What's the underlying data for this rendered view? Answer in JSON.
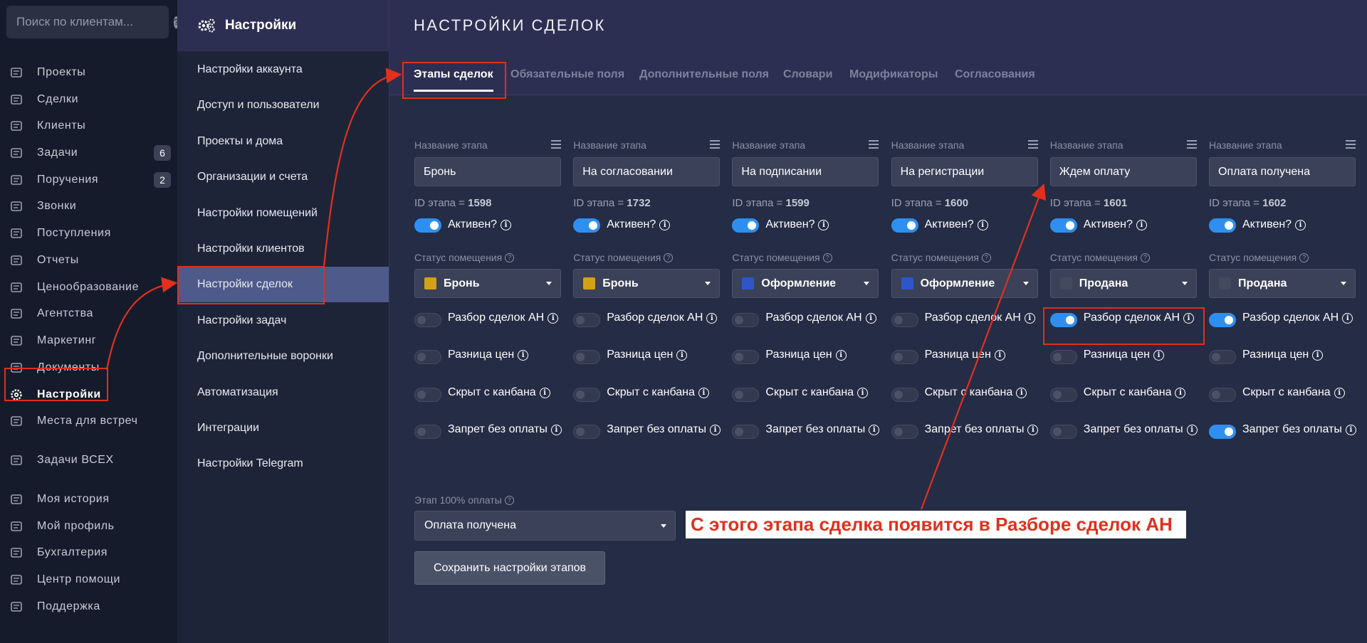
{
  "search": {
    "placeholder": "Поиск по клиентам..."
  },
  "nav": {
    "items": [
      {
        "label": "Проекты",
        "icon": "projects-icon"
      },
      {
        "label": "Сделки",
        "icon": "deals-icon"
      },
      {
        "label": "Клиенты",
        "icon": "clients-icon"
      },
      {
        "label": "Задачи",
        "icon": "tasks-icon",
        "badge": "6"
      },
      {
        "label": "Поручения",
        "icon": "assignments-icon",
        "badge": "2"
      },
      {
        "label": "Звонки",
        "icon": "calls-icon"
      },
      {
        "label": "Поступления",
        "icon": "receipts-icon"
      },
      {
        "label": "Отчеты",
        "icon": "reports-icon"
      },
      {
        "label": "Ценообразование",
        "icon": "pricing-icon"
      },
      {
        "label": "Агентства",
        "icon": "agencies-icon"
      },
      {
        "label": "Маркетинг",
        "icon": "marketing-icon"
      },
      {
        "label": "Документы",
        "icon": "documents-icon"
      },
      {
        "label": "Настройки",
        "icon": "gear-icon",
        "active": true
      },
      {
        "label": "Места для встреч",
        "icon": "meeting-places-icon"
      },
      {
        "label": "Задачи ВСЕХ",
        "icon": "all-tasks-icon"
      },
      {
        "label": "Моя история",
        "icon": "history-icon"
      },
      {
        "label": "Мой профиль",
        "icon": "profile-icon"
      },
      {
        "label": "Бухгалтерия",
        "icon": "accounting-icon"
      },
      {
        "label": "Центр помощи",
        "icon": "help-center-icon"
      },
      {
        "label": "Поддержка",
        "icon": "support-icon"
      }
    ]
  },
  "settings": {
    "title": "Настройки",
    "items": [
      "Настройки аккаунта",
      "Доступ и пользователи",
      "Проекты и дома",
      "Организации и счета",
      "Настройки помещений",
      "Настройки клиентов",
      "Настройки сделок",
      "Настройки задач",
      "Дополнительные воронки",
      "Автоматизация",
      "Интеграции",
      "Настройки Telegram"
    ],
    "active": "Настройки сделок"
  },
  "page": {
    "title": "НАСТРОЙКИ СДЕЛОК",
    "tabs": [
      "Этапы сделок",
      "Обязательные поля",
      "Дополнительные поля",
      "Словари",
      "Модификаторы",
      "Согласования"
    ],
    "active_tab": "Этапы сделок"
  },
  "labels": {
    "stage_name": "Название этапа",
    "stage_id_prefix": "ID этапа = ",
    "active": "Активен?",
    "room_status": "Статус помещения",
    "an_review": "Разбор сделок АН",
    "price_diff": "Разница цен",
    "hidden_kanban": "Скрыт с канбана",
    "no_payment_ban": "Запрет без оплаты"
  },
  "stages": [
    {
      "name": "Бронь",
      "id": "1598",
      "active": true,
      "status": "Бронь",
      "status_color": "#d4a017",
      "an_review": false,
      "price_diff": false,
      "hidden_kanban": false,
      "no_payment_ban": false
    },
    {
      "name": "На согласовании",
      "id": "1732",
      "active": true,
      "status": "Бронь",
      "status_color": "#d4a017",
      "an_review": false,
      "price_diff": false,
      "hidden_kanban": false,
      "no_payment_ban": false
    },
    {
      "name": "На подписании",
      "id": "1599",
      "active": true,
      "status": "Оформление",
      "status_color": "#2f56c9",
      "an_review": false,
      "price_diff": false,
      "hidden_kanban": false,
      "no_payment_ban": false
    },
    {
      "name": "На регистрации",
      "id": "1600",
      "active": true,
      "status": "Оформление",
      "status_color": "#2f56c9",
      "an_review": false,
      "price_diff": false,
      "hidden_kanban": false,
      "no_payment_ban": false
    },
    {
      "name": "Ждем оплату",
      "id": "1601",
      "active": true,
      "status": "Продана",
      "status_color": "#434a5e",
      "an_review": true,
      "price_diff": false,
      "hidden_kanban": false,
      "no_payment_ban": false
    },
    {
      "name": "Оплата получена",
      "id": "1602",
      "active": true,
      "status": "Продана",
      "status_color": "#434a5e",
      "an_review": true,
      "price_diff": false,
      "hidden_kanban": false,
      "no_payment_ban": true
    }
  ],
  "payment_stage": {
    "label": "Этап 100% оплаты",
    "value": "Оплата получена"
  },
  "save_button": "Сохранить настройки этапов",
  "annotation": {
    "callout": "С этого этапа сделка появится в Разборе сделок АН",
    "color": "#e0301e"
  }
}
